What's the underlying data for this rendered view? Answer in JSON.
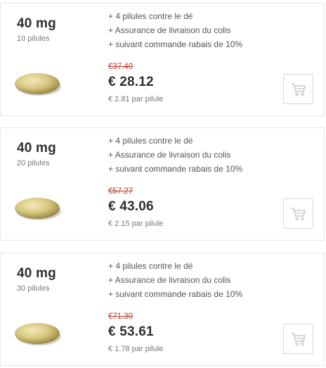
{
  "features": [
    "4 pilules contre le dé",
    "Assurance de livraison du colis",
    "suivant commande rabais de 10%"
  ],
  "colors": {
    "old_price": "#c0392b",
    "pill": "#d8c880",
    "border": "#e6e6e6"
  },
  "icons": {
    "cart": "shopping-cart-icon",
    "pill": "pill-image"
  },
  "offers": [
    {
      "dose": "40 mg",
      "count": "10 pilules",
      "old_price": "€37.40",
      "price": "€ 28.12",
      "per_pill": "€ 2.81 par pilule"
    },
    {
      "dose": "40 mg",
      "count": "20 pilules",
      "old_price": "€57.27",
      "price": "€ 43.06",
      "per_pill": "€ 2.15 par pilule"
    },
    {
      "dose": "40 mg",
      "count": "30 pilules",
      "old_price": "€71.30",
      "price": "€ 53.61",
      "per_pill": "€ 1.78 par pilule"
    }
  ]
}
